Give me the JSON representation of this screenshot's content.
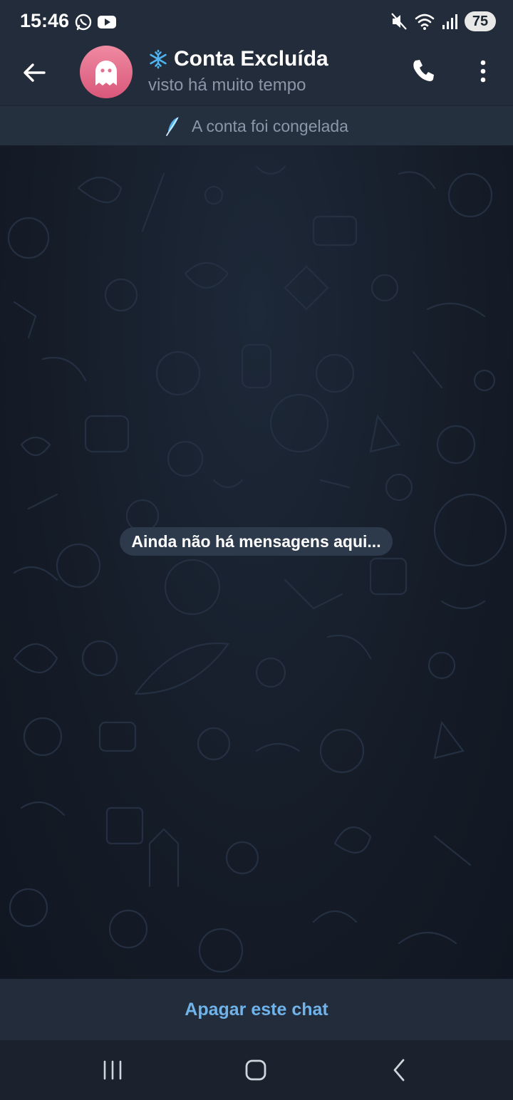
{
  "status_bar": {
    "time": "15:46",
    "left_icons": [
      "whatsapp-icon",
      "youtube-icon"
    ],
    "right_icons": [
      "mute-vibrate-icon",
      "wifi-icon",
      "signal-icon"
    ],
    "battery": "75"
  },
  "header": {
    "title": "Conta Excluída",
    "title_prefix_icon": "snowflake-icon",
    "last_seen": "visto há muito tempo",
    "avatar_icon": "ghost-icon"
  },
  "banner": {
    "icon": "feather-icon",
    "text": "A conta foi congelada"
  },
  "chat": {
    "empty_message": "Ainda não há mensagens aqui..."
  },
  "bottom_action": {
    "label": "Apagar este chat"
  },
  "colors": {
    "header_bg": "#232c3a",
    "chat_bg": "#141b26",
    "accent": "#6fb3ea",
    "avatar": "#e3708e",
    "snowflake": "#4fb3f0"
  }
}
